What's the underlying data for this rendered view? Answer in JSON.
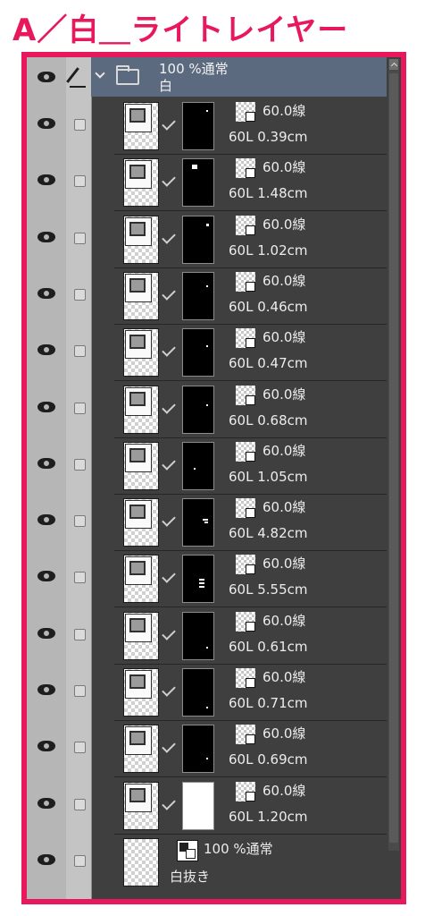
{
  "title": "A／白＿ライトレイヤー",
  "colors": {
    "accent_frame": "#e8185d",
    "panel_bg": "#3f3f3f",
    "group_selected": "#5c6a80"
  },
  "group": {
    "opacity_mode": "100 %通常",
    "name": "白",
    "icon": "folder-icon",
    "expanded": true
  },
  "layers": [
    {
      "line1": "60.0線",
      "line2": "60L 0.39cm"
    },
    {
      "line1": "60.0線",
      "line2": "60L 1.48cm"
    },
    {
      "line1": "60.0線",
      "line2": "60L 1.02cm"
    },
    {
      "line1": "60.0線",
      "line2": "60L 0.46cm"
    },
    {
      "line1": "60.0線",
      "line2": "60L 0.47cm"
    },
    {
      "line1": "60.0線",
      "line2": "60L 0.68cm"
    },
    {
      "line1": "60.0線",
      "line2": "60L 1.05cm"
    },
    {
      "line1": "60.0線",
      "line2": "60L 4.82cm"
    },
    {
      "line1": "60.0線",
      "line2": "60L 5.55cm"
    },
    {
      "line1": "60.0線",
      "line2": "60L 0.61cm"
    },
    {
      "line1": "60.0線",
      "line2": "60L 0.71cm"
    },
    {
      "line1": "60.0線",
      "line2": "60L 0.69cm"
    },
    {
      "line1": "60.0線",
      "line2": "60L 1.20cm"
    }
  ],
  "base_layer": {
    "opacity_mode": "100 %通常",
    "name": "白抜き"
  }
}
